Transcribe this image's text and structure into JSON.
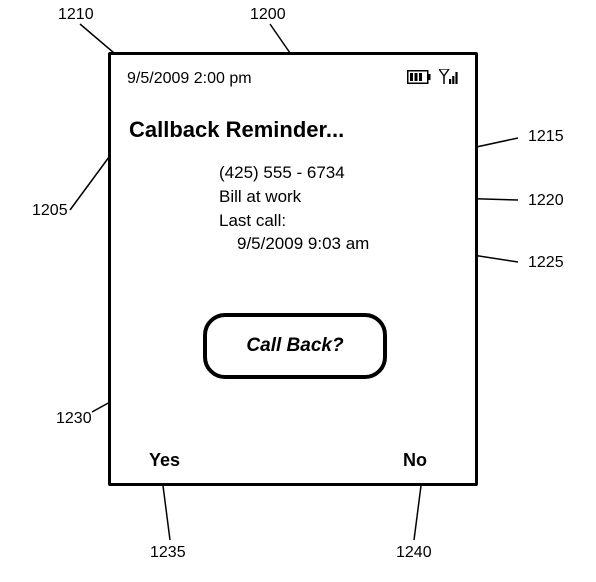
{
  "status": {
    "datetime": "9/5/2009 2:00 pm"
  },
  "title": "Callback Reminder...",
  "info": {
    "phone": "(425) 555 - 6734",
    "name": "Bill at work",
    "lastcall_label": "Last call:",
    "lastcall_time": "9/5/2009 9:03 am"
  },
  "button": {
    "label": "Call Back?"
  },
  "softkeys": {
    "yes": "Yes",
    "no": "No"
  },
  "refs": {
    "r1200": "1200",
    "r1205": "1205",
    "r1210": "1210",
    "r1215": "1215",
    "r1220": "1220",
    "r1225": "1225",
    "r1230": "1230",
    "r1235": "1235",
    "r1240": "1240"
  }
}
